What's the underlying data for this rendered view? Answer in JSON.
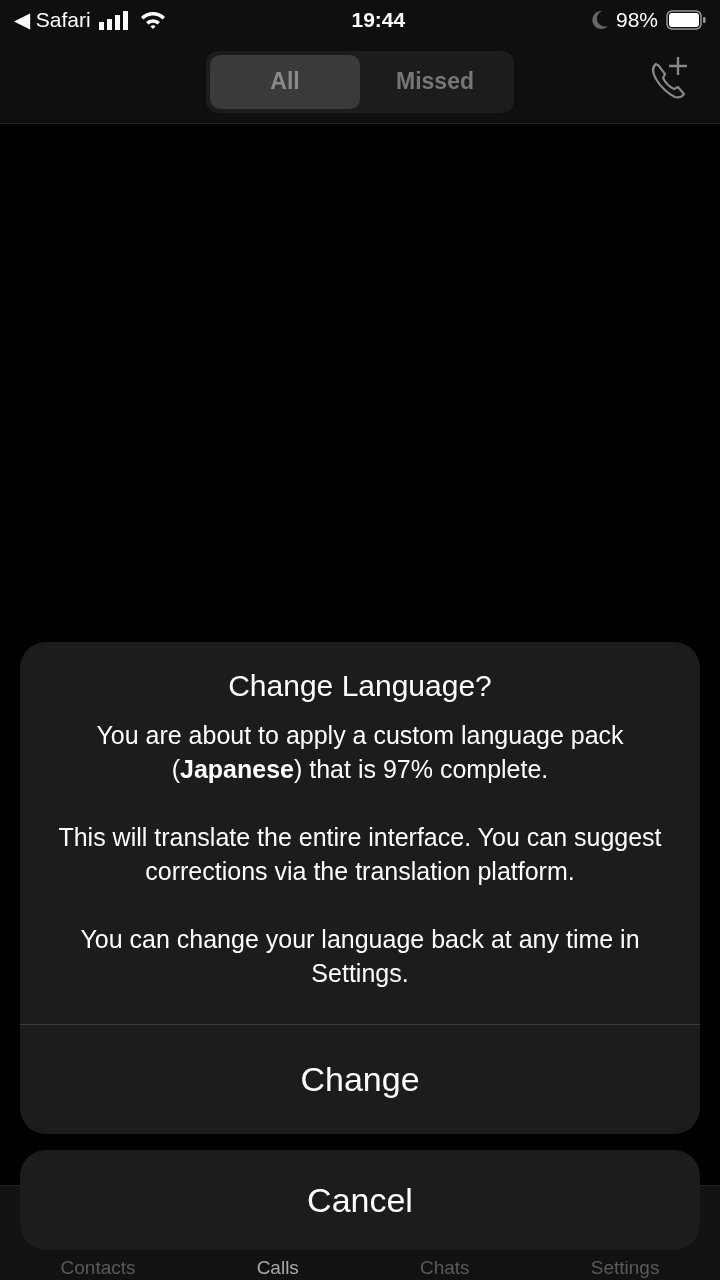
{
  "status_bar": {
    "back_app": "◀ Safari",
    "time": "19:44",
    "battery": "98%"
  },
  "segments": [
    {
      "label": "All",
      "selected": true
    },
    {
      "label": "Missed",
      "selected": false
    }
  ],
  "tab_bar": [
    {
      "label": "Contacts",
      "selected": false
    },
    {
      "label": "Calls",
      "selected": true
    },
    {
      "label": "Chats",
      "selected": false
    },
    {
      "label": "Settings",
      "selected": false
    }
  ],
  "alert": {
    "title": "Change Language?",
    "paragraphs": [
      "You are about to apply a custom language pack (**Japanese**) that is 97% complete.",
      "This will translate the entire interface. You can suggest corrections via the translation platform.",
      "You can change your language back at any time in Settings."
    ],
    "action": "Change",
    "cancel": "Cancel"
  }
}
